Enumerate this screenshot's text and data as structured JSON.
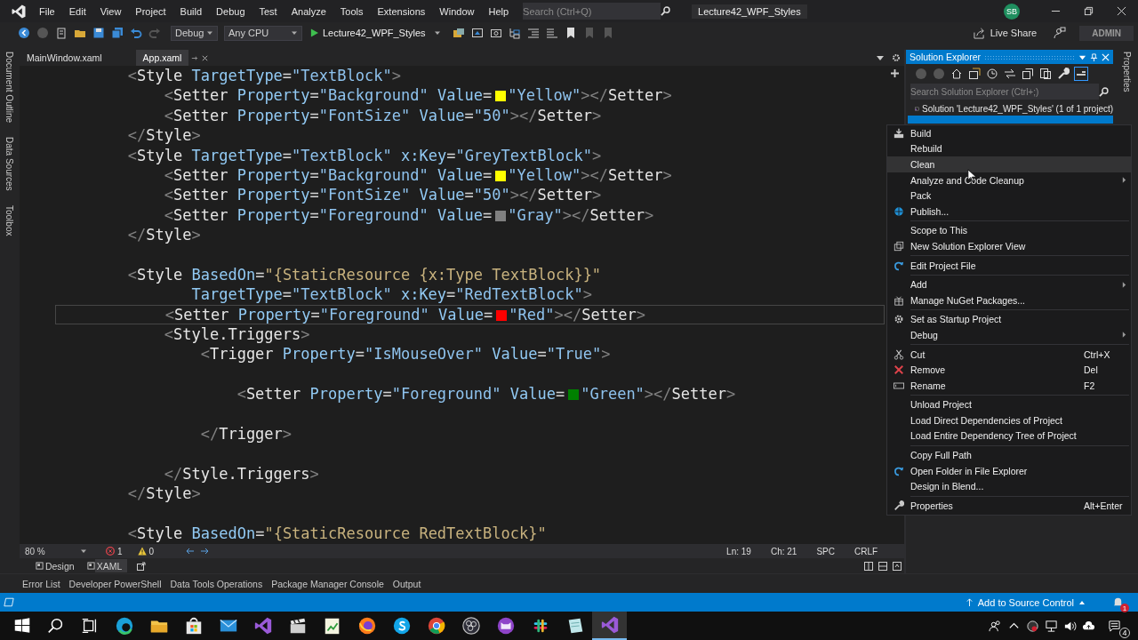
{
  "title_bar": {
    "menu": [
      "File",
      "Edit",
      "View",
      "Project",
      "Build",
      "Debug",
      "Test",
      "Analyze",
      "Tools",
      "Extensions",
      "Window",
      "Help"
    ],
    "search": {
      "placeholder": "Search (Ctrl+Q)"
    },
    "title": "Lecture42_WPF_Styles",
    "avatar": "SB"
  },
  "toolbar": {
    "configuration": "Debug",
    "platform": "Any CPU",
    "start": "Lecture42_WPF_Styles",
    "live_share": "Live Share",
    "account": "ADMIN"
  },
  "side_tabs": [
    "Document Outline",
    "Data Sources",
    "Toolbox"
  ],
  "document_tabs": [
    {
      "label": "MainWindow.xaml",
      "selected": false
    },
    {
      "label": "App.xaml",
      "selected": true
    }
  ],
  "editor": {
    "lines": [
      {
        "kind": "code",
        "current": false,
        "segments": [
          {
            "kind": "text",
            "text": "<Style TargetType=\"TextBlock\">"
          }
        ],
        "children": [
          {
            "kind": "code",
            "current": false,
            "segments": [
              {
                "kind": "text",
                "text": "<Setter Property=\"Background\" Value="
              },
              {
                "kind": "swatch",
                "color": "#ffff00"
              },
              {
                "kind": "text",
                "text": "\"Yellow\"></Setter>"
              }
            ]
          },
          {
            "kind": "code",
            "current": false,
            "segments": [
              {
                "kind": "text",
                "text": "<Setter Property=\"FontSize\" Value=\"50\"></Setter>"
              }
            ]
          }
        ]
      },
      {
        "kind": "code",
        "current": false,
        "segments": [
          {
            "kind": "text",
            "text": "</Style>"
          }
        ]
      },
      {
        "kind": "code",
        "current": false,
        "segments": [
          {
            "kind": "text",
            "text": "<Style TargetType=\"TextBlock\" x:Key=\"GreyTextBlock\">"
          }
        ],
        "children": [
          {
            "kind": "code",
            "current": false,
            "segments": [
              {
                "kind": "text",
                "text": "<Setter Property=\"Background\" Value="
              },
              {
                "kind": "swatch",
                "color": "#ffff00"
              },
              {
                "kind": "text",
                "text": "\"Yellow\"></Setter>"
              }
            ]
          },
          {
            "kind": "code",
            "current": false,
            "segments": [
              {
                "kind": "text",
                "text": "<Setter Property=\"FontSize\" Value=\"50\"></Setter>"
              }
            ]
          },
          {
            "kind": "code",
            "current": false,
            "segments": [
              {
                "kind": "text",
                "text": "<Setter Property=\"Foreground\" Value="
              },
              {
                "kind": "swatch",
                "color": "#808080"
              },
              {
                "kind": "text",
                "text": "\"Gray\"></Setter>"
              }
            ]
          }
        ]
      },
      {
        "kind": "code",
        "current": false,
        "segments": [
          {
            "kind": "text",
            "text": "</Style>"
          }
        ]
      },
      {
        "kind": "blank"
      },
      {
        "kind": "code",
        "current": false,
        "segments": [
          {
            "kind": "text",
            "text": "<Style BasedOn=\"{StaticResource {x:Type TextBlock}}\""
          }
        ],
        "children": [
          {
            "kind": "continuation",
            "current": false,
            "segments": [
              {
                "kind": "text",
                "text": "TargetType=\"TextBlock\" x:Key=\"RedTextBlock\">"
              }
            ]
          },
          {
            "kind": "code",
            "current": true,
            "segments": [
              {
                "kind": "text",
                "text": "<Setter Property=\"Foreground\" Value="
              },
              {
                "kind": "swatch",
                "color": "#ff0000"
              },
              {
                "kind": "text",
                "text": "\"Red\"></Setter>"
              }
            ]
          },
          {
            "kind": "code",
            "current": false,
            "segments": [
              {
                "kind": "text",
                "text": "<Style.Triggers>"
              }
            ],
            "children": [
              {
                "kind": "code",
                "current": false,
                "segments": [
                  {
                    "kind": "text",
                    "text": "<Trigger Property=\"IsMouseOver\" Value=\"True\">"
                  }
                ],
                "children": [
                  {
                    "kind": "blank"
                  },
                  {
                    "kind": "code",
                    "current": false,
                    "segments": [
                      {
                        "kind": "text",
                        "text": "<Setter Property=\"Foreground\" Value="
                      },
                      {
                        "kind": "swatch",
                        "color": "#008000"
                      },
                      {
                        "kind": "text",
                        "text": "\"Green\"></Setter>"
                      }
                    ]
                  },
                  {
                    "kind": "blank"
                  }
                ]
              },
              {
                "kind": "code",
                "current": false,
                "segments": [
                  {
                    "kind": "text",
                    "text": "</Trigger>"
                  }
                ]
              },
              {
                "kind": "blank"
              }
            ]
          },
          {
            "kind": "code",
            "current": false,
            "segments": [
              {
                "kind": "text",
                "text": "</Style.Triggers>"
              }
            ]
          }
        ]
      },
      {
        "kind": "code",
        "current": false,
        "segments": [
          {
            "kind": "text",
            "text": "</Style>"
          }
        ]
      },
      {
        "kind": "blank"
      },
      {
        "kind": "code",
        "current": false,
        "segments": [
          {
            "kind": "text",
            "text": "<Style BasedOn=\"{StaticResource RedTextBlock}\""
          }
        ]
      }
    ],
    "status": {
      "zoom": "80 %",
      "errors": "1",
      "warnings": "0",
      "line": "Ln: 19",
      "column": "Ch: 21",
      "whitespace": "SPC",
      "line_ending": "CRLF"
    },
    "view_tabs": [
      {
        "label": "Design",
        "selected": false
      },
      {
        "label": "XAML",
        "selected": true
      }
    ]
  },
  "solution_explorer": {
    "title": "Solution Explorer",
    "search": {
      "placeholder": "Search Solution Explorer (Ctrl+;)"
    },
    "solution": "Solution 'Lecture42_WPF_Styles' (1 of 1 project)"
  },
  "properties_tab": "Properties",
  "context_menu": {
    "groups": [
      [
        {
          "label": "Build",
          "submenu": false,
          "highlighted": false
        },
        {
          "label": "Rebuild",
          "submenu": false,
          "highlighted": false
        },
        {
          "label": "Clean",
          "submenu": false,
          "highlighted": true
        },
        {
          "label": "Analyze and Code Cleanup",
          "submenu": true,
          "highlighted": false
        },
        {
          "label": "Pack",
          "submenu": false,
          "highlighted": false
        },
        {
          "label": "Publish...",
          "submenu": false,
          "highlighted": false
        }
      ],
      [
        {
          "label": "Scope to This",
          "submenu": false,
          "highlighted": false
        },
        {
          "label": "New Solution Explorer View",
          "submenu": false,
          "highlighted": false
        }
      ],
      [
        {
          "label": "Edit Project File",
          "submenu": false,
          "highlighted": false
        }
      ],
      [
        {
          "label": "Add",
          "submenu": true,
          "highlighted": false
        },
        {
          "label": "Manage NuGet Packages...",
          "submenu": false,
          "highlighted": false
        }
      ],
      [
        {
          "label": "Set as Startup Project",
          "submenu": false,
          "highlighted": false
        },
        {
          "label": "Debug",
          "submenu": true,
          "highlighted": false
        }
      ],
      [
        {
          "label": "Cut",
          "shortcut": "Ctrl+X",
          "submenu": false,
          "highlighted": false
        },
        {
          "label": "Remove",
          "shortcut": "Del",
          "submenu": false,
          "highlighted": false
        },
        {
          "label": "Rename",
          "shortcut": "F2",
          "submenu": false,
          "highlighted": false
        }
      ],
      [
        {
          "label": "Unload Project",
          "submenu": false,
          "highlighted": false
        },
        {
          "label": "Load Direct Dependencies of Project",
          "submenu": false,
          "highlighted": false
        },
        {
          "label": "Load Entire Dependency Tree of Project",
          "submenu": false,
          "highlighted": false
        }
      ],
      [
        {
          "label": "Copy Full Path",
          "submenu": false,
          "highlighted": false
        },
        {
          "label": "Open Folder in File Explorer",
          "submenu": false,
          "highlighted": false
        },
        {
          "label": "Design in Blend...",
          "submenu": false,
          "highlighted": false
        }
      ],
      [
        {
          "label": "Properties",
          "shortcut": "Alt+Enter",
          "submenu": false,
          "highlighted": false
        }
      ]
    ]
  },
  "tool_tabs": [
    "Error List",
    "Developer PowerShell",
    "Data Tools Operations",
    "Package Manager Console",
    "Output"
  ],
  "status_bar": {
    "source_control": "Add to Source Control",
    "notifications": "1"
  },
  "taskbar": {
    "apps": [
      {
        "selected": false
      },
      {
        "selected": false
      },
      {
        "selected": false
      },
      {
        "selected": false
      },
      {
        "selected": false
      },
      {
        "selected": false
      },
      {
        "selected": false
      },
      {
        "selected": false
      },
      {
        "selected": false
      },
      {
        "selected": false
      },
      {
        "selected": false
      },
      {
        "selected": false
      },
      {
        "selected": false
      },
      {
        "selected": false
      },
      {
        "selected": true
      }
    ],
    "notifications": "4"
  }
}
